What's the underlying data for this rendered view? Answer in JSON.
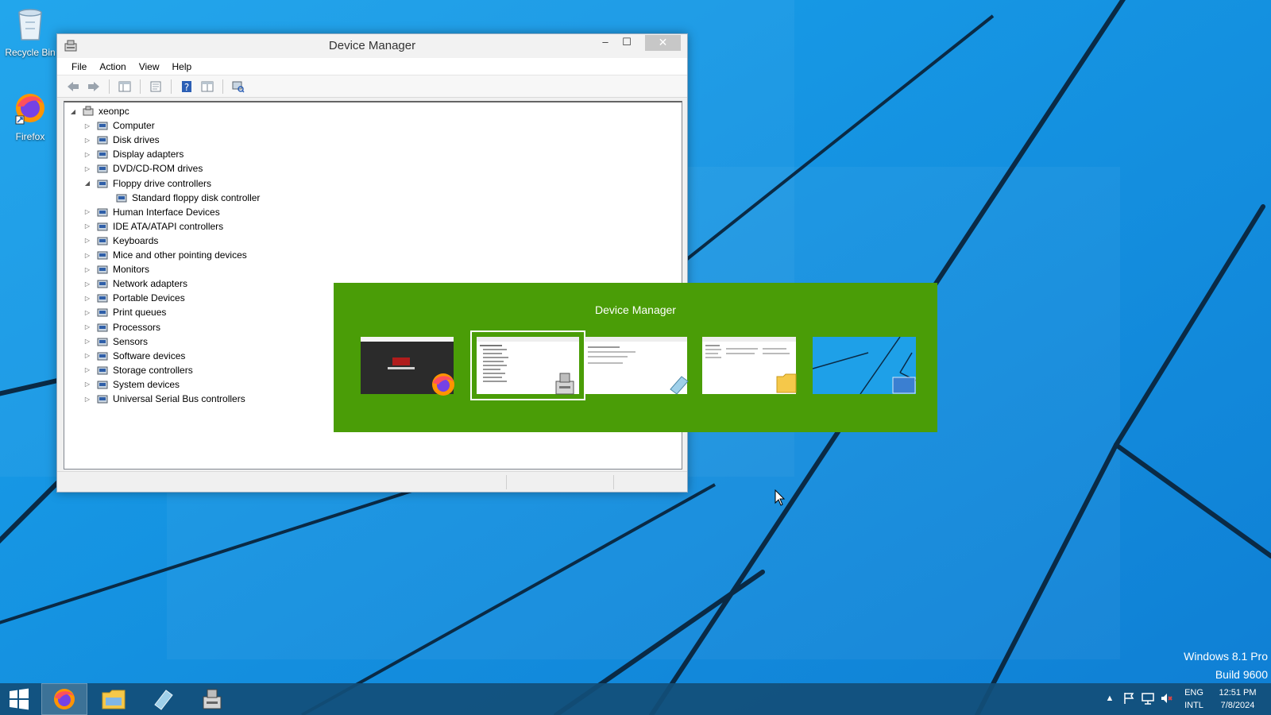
{
  "desktop": {
    "icons": [
      {
        "label": "Recycle Bin",
        "icon": "recycle-bin-icon"
      },
      {
        "label": "Firefox",
        "icon": "firefox-icon"
      }
    ]
  },
  "device_manager": {
    "title": "Device Manager",
    "controls": {
      "minimize": "–",
      "maximize": "☐",
      "close": "✕"
    },
    "menu": [
      "File",
      "Action",
      "View",
      "Help"
    ],
    "toolbar": [
      "back-icon",
      "forward-icon",
      "show-hide-tree-icon",
      "properties-icon",
      "help-icon",
      "console-view-icon",
      "scan-hardware-icon"
    ],
    "tree": {
      "root": "xeonpc",
      "nodes": [
        {
          "label": "Computer",
          "expanded": false
        },
        {
          "label": "Disk drives",
          "expanded": false
        },
        {
          "label": "Display adapters",
          "expanded": false
        },
        {
          "label": "DVD/CD-ROM drives",
          "expanded": false
        },
        {
          "label": "Floppy drive controllers",
          "expanded": true,
          "children": [
            "Standard floppy disk controller"
          ]
        },
        {
          "label": "Human Interface Devices",
          "expanded": false
        },
        {
          "label": "IDE ATA/ATAPI controllers",
          "expanded": false
        },
        {
          "label": "Keyboards",
          "expanded": false
        },
        {
          "label": "Mice and other pointing devices",
          "expanded": false
        },
        {
          "label": "Monitors",
          "expanded": false
        },
        {
          "label": "Network adapters",
          "expanded": false
        },
        {
          "label": "Portable Devices",
          "expanded": false
        },
        {
          "label": "Print queues",
          "expanded": false
        },
        {
          "label": "Processors",
          "expanded": false
        },
        {
          "label": "Sensors",
          "expanded": false
        },
        {
          "label": "Software devices",
          "expanded": false
        },
        {
          "label": "Storage controllers",
          "expanded": false
        },
        {
          "label": "System devices",
          "expanded": false
        },
        {
          "label": "Universal Serial Bus controllers",
          "expanded": false
        }
      ]
    }
  },
  "switcher": {
    "title": "Device Manager",
    "selected_index": 1,
    "thumbnails": [
      {
        "app": "Firefox",
        "badge": "firefox-icon"
      },
      {
        "app": "Device Manager",
        "badge": "device-manager-icon"
      },
      {
        "app": "Notepad",
        "badge": "notepad-icon"
      },
      {
        "app": "File Explorer",
        "badge": "folder-icon"
      },
      {
        "app": "Desktop",
        "badge": "desktop-icon"
      }
    ]
  },
  "watermark": {
    "line1": "Windows 8.1 Pro",
    "line2": "Build 9600"
  },
  "taskbar": {
    "items": [
      "firefox-icon",
      "file-explorer-icon",
      "notepad-icon",
      "device-manager-icon"
    ],
    "active_index": 0,
    "tray": {
      "icons": [
        "show-hidden-icons-arrow",
        "action-center-flag-icon",
        "network-icon",
        "volume-muted-icon"
      ],
      "language": "ENG",
      "layout": "INTL",
      "time": "12:51 PM",
      "date": "7/8/2024"
    }
  },
  "colors": {
    "desktop": "#1ea0e8",
    "switcher": "#4a9d07",
    "taskbar": "#124e78"
  }
}
